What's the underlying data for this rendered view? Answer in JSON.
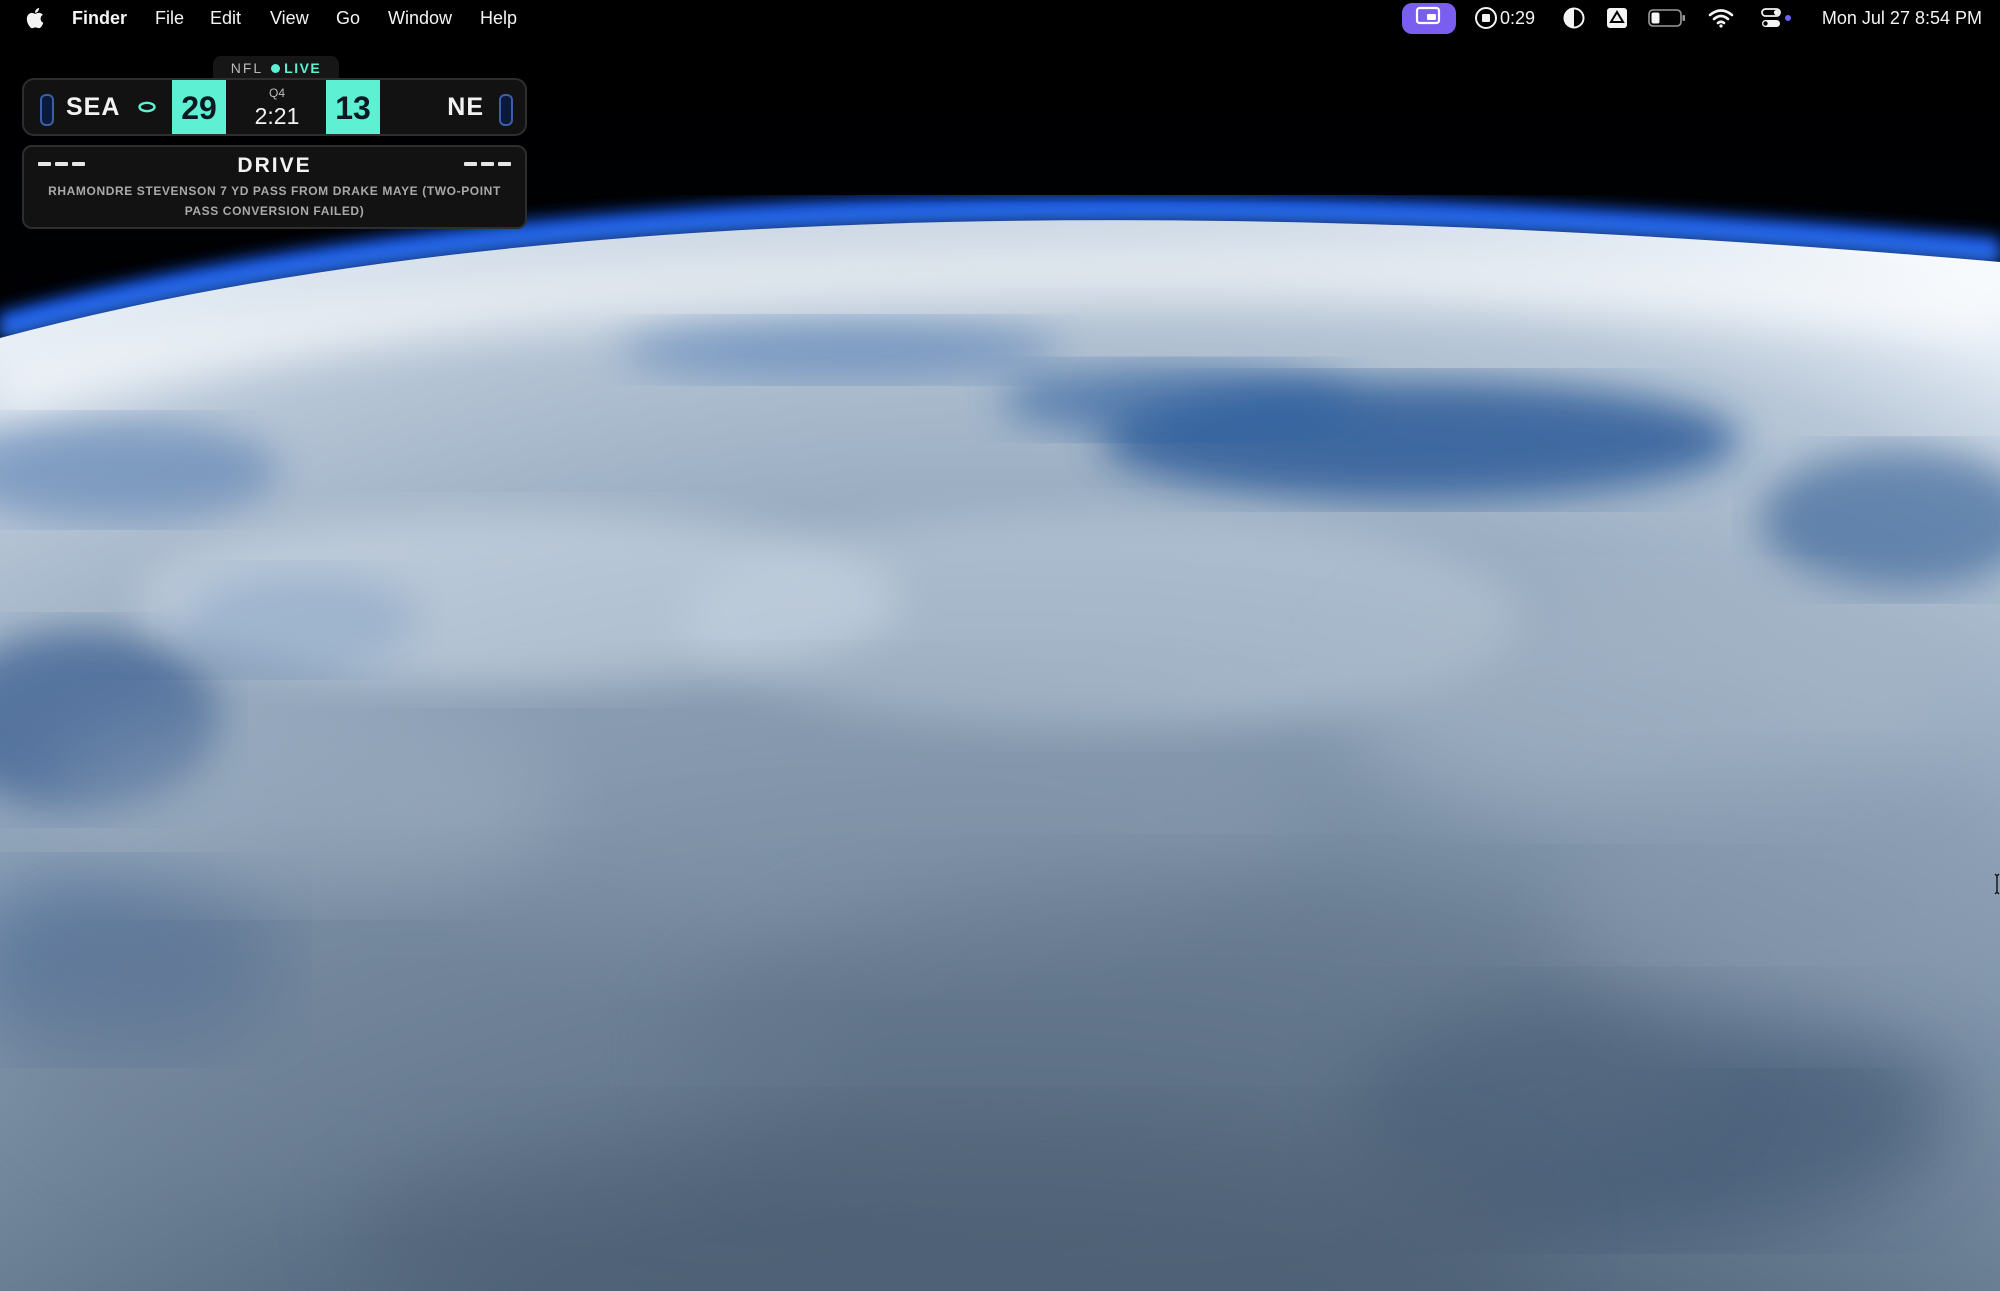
{
  "menubar": {
    "app_name": "Finder",
    "menus": [
      "File",
      "Edit",
      "View",
      "Go",
      "Window",
      "Help"
    ],
    "status": {
      "screen_share_icon": "screen-share-icon",
      "pill_color": "#7a5ef0",
      "timer_icon": "stop-recording-icon",
      "timer": "0:29",
      "contrast_icon": "display-contrast-icon",
      "drive_icon": "google-drive-icon",
      "battery_icon": "battery-icon",
      "wifi_icon": "wifi-icon",
      "control_center_icon": "control-center-icon",
      "datetime": "Mon Jul 27  8:54 PM"
    }
  },
  "score_widget": {
    "league": "NFL",
    "live_label": "LIVE",
    "accent": "#5ef0d2",
    "home": {
      "abbr": "SEA",
      "score": "29",
      "has_possession": true
    },
    "away": {
      "abbr": "NE",
      "score": "13"
    },
    "period": "Q4",
    "clock": "2:21",
    "drive": {
      "title": "DRIVE",
      "description": "RHAMONDRE STEVENSON 7 YD PASS FROM DRAKE MAYE (TWO-POINT PASS CONVERSION FAILED)"
    }
  },
  "wallpaper": {
    "subject": "earth-from-orbit"
  }
}
